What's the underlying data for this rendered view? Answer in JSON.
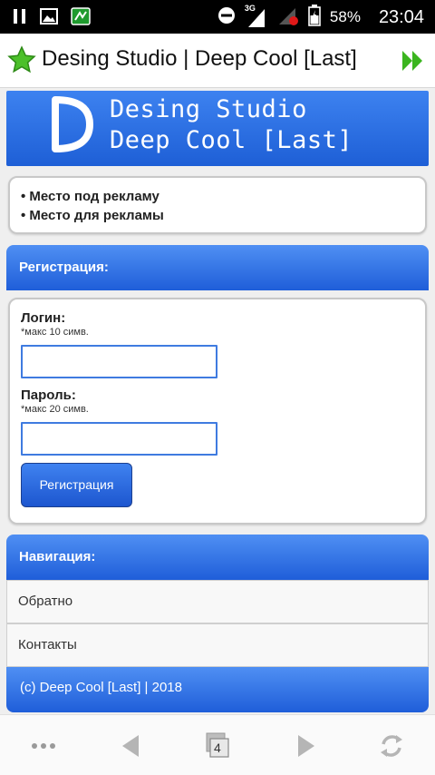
{
  "status_bar": {
    "network": "3G",
    "battery": "58%",
    "time": "23:04"
  },
  "title_bar": {
    "title": "Desing Studio | Deep Cool [Last]"
  },
  "banner": {
    "letter": "D",
    "line1": "Desing Studio",
    "line2": "Deep Cool [Last]"
  },
  "ads": {
    "item1": "• Место под рекламу",
    "item2": "• Место для рекламы"
  },
  "registration": {
    "header": "Регистрация:",
    "login_label": "Логин:",
    "login_hint": "*макс 10 симв.",
    "login_value": "",
    "password_label": "Пароль:",
    "password_hint": "*макс 20 симв.",
    "password_value": "",
    "submit_label": "Регистрация"
  },
  "navigation": {
    "header": "Навигация:",
    "items": [
      {
        "label": "Обратно"
      },
      {
        "label": "Контакты"
      }
    ]
  },
  "footer": {
    "text": "(c) Deep Cool [Last] | 2018"
  },
  "toolbar": {
    "tab_count": "4"
  },
  "colors": {
    "accent_blue": "#2a6de3",
    "header_blue": "#1f5ed9",
    "input_border": "#3f7be0",
    "star": "#3bb51f"
  }
}
